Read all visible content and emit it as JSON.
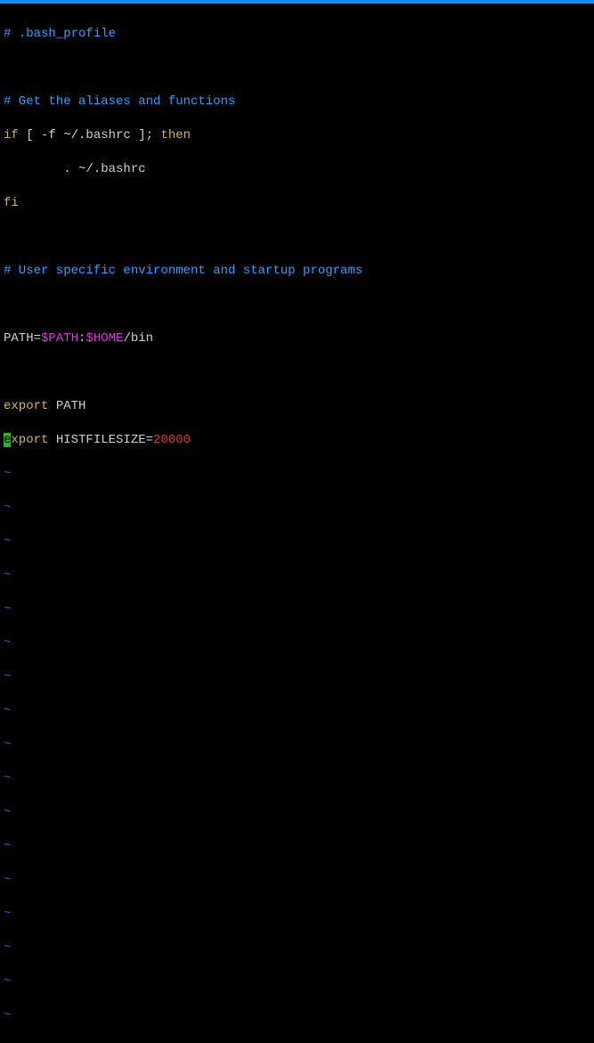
{
  "file": {
    "l1": "# .bash_profile",
    "l3": "# Get the aliases and functions",
    "l4_if": "if",
    "l4_cond": " [ -f ~/.bashrc ]; ",
    "l4_then": "then",
    "l5_indent": "        . ~/.bashrc",
    "l6_fi": "fi",
    "l8": "# User specific environment and startup programs",
    "l10_path_lhs": "PATH=",
    "l10_var1": "$PATH",
    "l10_sep": ":",
    "l10_var2": "$HOME",
    "l10_tail": "/bin",
    "l12_export": "export",
    "l12_arg": " PATH",
    "l13_cursor": "e",
    "l13_export_rest": "xport",
    "l13_mid": " HISTFILESIZE=",
    "l13_num": "20000"
  },
  "tilde": "~"
}
